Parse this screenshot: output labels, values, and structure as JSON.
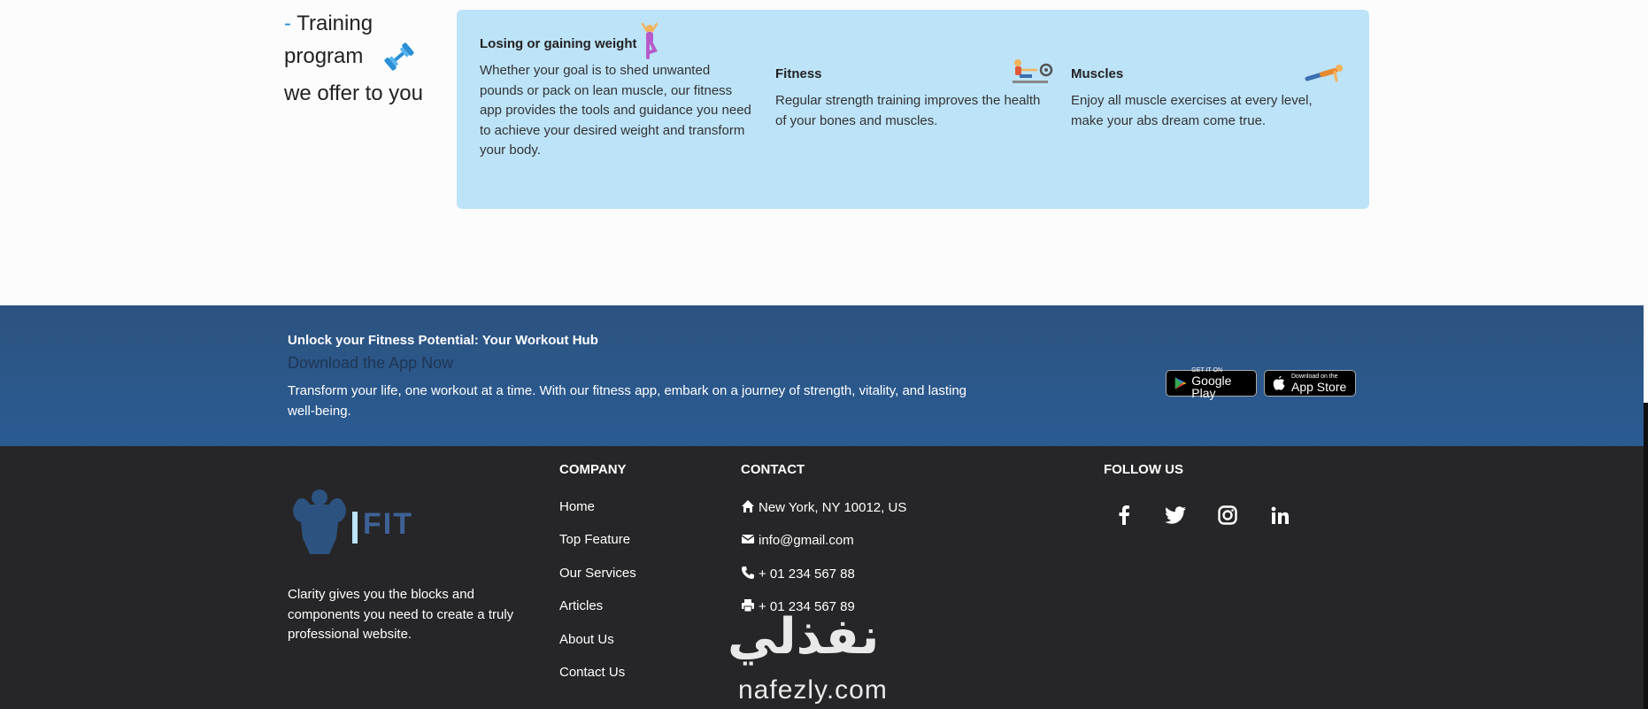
{
  "training": {
    "dash": "-",
    "title_line1": "Training",
    "title_line2": "program",
    "title_line3": "we offer to you"
  },
  "features": [
    {
      "title": "Losing or gaining weight",
      "text": "Whether your goal is to shed unwanted pounds or pack on lean muscle, our fitness app provides the tools and guidance you need to achieve your desired weight and transform your body.",
      "icon": "person-yoga-icon"
    },
    {
      "title": "Fitness",
      "text": "Regular strength training improves the health of your bones and muscles.",
      "icon": "rowing-machine-icon"
    },
    {
      "title": "Muscles",
      "text": "Enjoy all muscle exercises at every level, make your abs dream come true.",
      "icon": "plank-exercise-icon"
    }
  ],
  "download": {
    "subtitle": "Unlock your Fitness Potential: Your Workout Hub",
    "title": "Download the App Now",
    "text": "Transform your life, one workout at a time. With our fitness app, embark on a journey of strength, vitality, and lasting well-being.",
    "google_small": "GET IT ON",
    "google_big": "Google Play",
    "apple_small": "Download on the",
    "apple_big": "App Store"
  },
  "footer": {
    "logo_text": "FIT",
    "about": "Clarity gives you the blocks and components you need to create a truly professional website.",
    "company_heading": "COMPANY",
    "company_links": [
      "Home",
      "Top Feature",
      "Our Services",
      "Articles",
      "About Us",
      "Contact Us"
    ],
    "contact_heading": "CONTACT",
    "address": "New York, NY 10012, US",
    "email": "info@gmail.com",
    "phone": "+ 01 234 567 88",
    "fax": "+ 01 234 567 89",
    "follow_heading": "FOLLOW US",
    "social": [
      "facebook-icon",
      "twitter-icon",
      "instagram-icon",
      "linkedin-icon"
    ]
  },
  "watermark": {
    "arabic": "نفذلي",
    "latin": "nafezly.com"
  },
  "colors": {
    "accent": "#2a8fd6",
    "card_bg": "#bde3f8",
    "band_bg": "#2c5380",
    "footer_bg": "#262628"
  }
}
